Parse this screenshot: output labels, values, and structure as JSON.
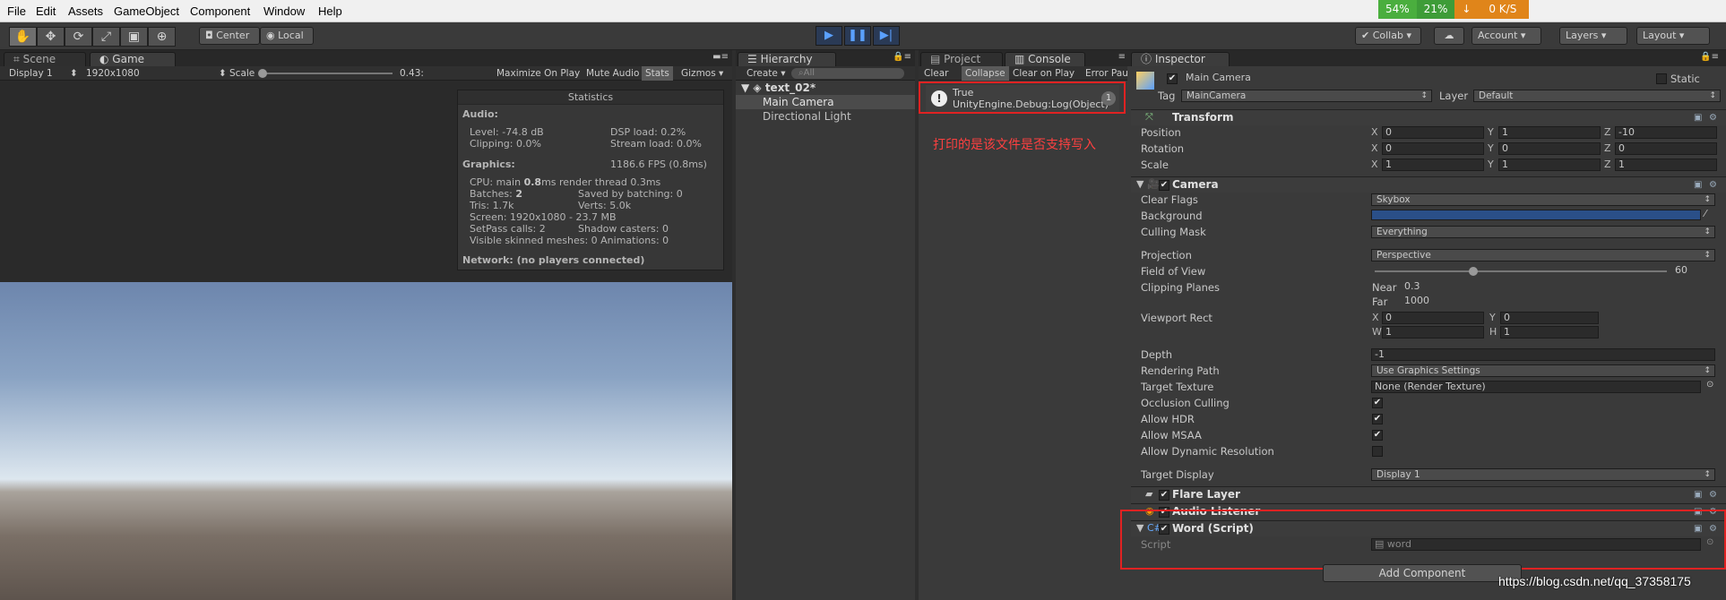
{
  "menu": [
    "File",
    "Edit",
    "Assets",
    "GameObject",
    "Component",
    "Window",
    "Help"
  ],
  "netmon": {
    "cpu": "54%",
    "mem": "21%",
    "arrow": "↓",
    "speed": "0 K/S"
  },
  "toolbar": {
    "center": "Center",
    "local": "Local",
    "collab": "Collab",
    "account": "Account",
    "layers": "Layers",
    "layout": "Layout"
  },
  "tool_icons": [
    "hand-icon",
    "move-icon",
    "rotate-icon",
    "scale-icon",
    "rect-icon",
    "transform-icon"
  ],
  "scene_tabs": {
    "scene": "Scene",
    "game": "Game"
  },
  "game_bar": {
    "display": "Display 1",
    "resolution": "1920x1080",
    "scale_label": "Scale",
    "scale_value": "0.43:",
    "maximize": "Maximize On Play",
    "mute": "Mute Audio",
    "stats": "Stats",
    "gizmos": "Gizmos"
  },
  "stats": {
    "title": "Statistics",
    "audio": "Audio:",
    "level": "Level: -74.8 dB",
    "dsp": "DSP load: 0.2%",
    "clipping": "Clipping: 0.0%",
    "stream": "Stream load: 0.0%",
    "graphics": "Graphics:",
    "fps": "1186.6 FPS (0.8ms)",
    "cpu_a": "CPU: main ",
    "cpu_b": "0.8",
    "cpu_c": "ms  render thread 0.3ms",
    "batches_a": "Batches: ",
    "batches_b": "2",
    "saved": "Saved by batching: 0",
    "tris": "Tris: 1.7k",
    "verts": "Verts: 5.0k",
    "screen": "Screen: 1920x1080 - 23.7 MB",
    "setpass": "SetPass calls: 2",
    "shadow": "Shadow casters: 0",
    "skinned": "Visible skinned meshes: 0  Animations: 0",
    "network": "Network: (no players connected)"
  },
  "hierarchy": {
    "tab": "Hierarchy",
    "create": "Create",
    "search": "All",
    "scene": "text_02*",
    "items": [
      "Main Camera",
      "Directional Light"
    ]
  },
  "console": {
    "project_tab": "Project",
    "console_tab": "Console",
    "buttons": [
      "Clear",
      "Collapse",
      "Clear on Play",
      "Error Pau"
    ],
    "log_line1": "True",
    "log_line2": "UnityEngine.Debug:Log(Object)",
    "count": "1",
    "annotation": "打印的是该文件是否支持写入"
  },
  "inspector": {
    "tab": "Inspector",
    "name": "Main Camera",
    "static": "Static",
    "tag_label": "Tag",
    "tag": "MainCamera",
    "layer_label": "Layer",
    "layer": "Default",
    "transform": {
      "title": "Transform",
      "position": "Position",
      "rotation": "Rotation",
      "scale": "Scale",
      "pos": [
        "0",
        "1",
        "-10"
      ],
      "rot": [
        "0",
        "0",
        "0"
      ],
      "scl": [
        "1",
        "1",
        "1"
      ]
    },
    "camera": {
      "title": "Camera",
      "clear_flags": "Clear Flags",
      "clear_flags_val": "Skybox",
      "background": "Background",
      "background_color": "#2a4f88",
      "culling": "Culling Mask",
      "culling_val": "Everything",
      "projection": "Projection",
      "projection_val": "Perspective",
      "fov": "Field of View",
      "fov_val": "60",
      "clipping": "Clipping Planes",
      "near": "Near",
      "near_val": "0.3",
      "far": "Far",
      "far_val": "1000",
      "viewport": "Viewport Rect",
      "vx": "0",
      "vy": "0",
      "vw": "1",
      "vh": "1",
      "depth": "Depth",
      "depth_val": "-1",
      "rpath": "Rendering Path",
      "rpath_val": "Use Graphics Settings",
      "ttex": "Target Texture",
      "ttex_val": "None (Render Texture)",
      "occlusion": "Occlusion Culling",
      "hdr": "Allow HDR",
      "msaa": "Allow MSAA",
      "dynres": "Allow Dynamic Resolution",
      "tdisplay": "Target Display",
      "tdisplay_val": "Display 1"
    },
    "flare": "Flare Layer",
    "audio": "Audio Listener",
    "word": "Word (Script)",
    "script_label": "Script",
    "script_val": "word",
    "add_component": "Add Component"
  },
  "watermark": "https://blog.csdn.net/qq_37358175"
}
